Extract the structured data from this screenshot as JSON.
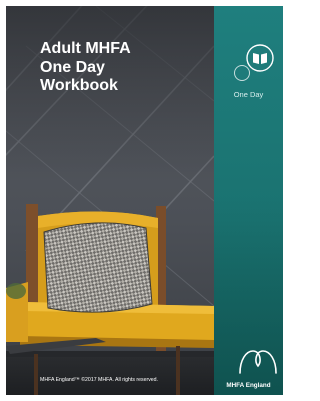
{
  "cover": {
    "title_lines": [
      "Adult MHFA",
      "One Day",
      "Workbook"
    ],
    "course_label": "One Day",
    "brand_name": "MHFA England",
    "copyright": "MHFA England™ ©2017 MHFA. All rights reserved."
  },
  "colors": {
    "teal_panel": "#1f7f7e",
    "chair_yellow": "#e0a81e",
    "title_text": "#ffffff"
  },
  "icons": {
    "course_icon": "open-book-icon",
    "brand_logo": "mhfa-england-logo"
  }
}
